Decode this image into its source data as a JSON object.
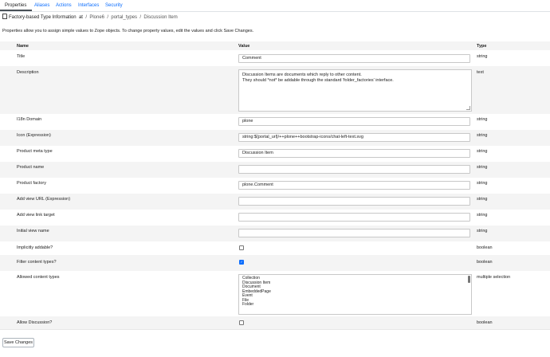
{
  "tabs": [
    "Properties",
    "Aliases",
    "Actions",
    "Interfaces",
    "Security"
  ],
  "breadcrumb": {
    "type_label": "Factory-based Type Information",
    "at": "at",
    "sep": "/",
    "path": [
      "Plone6",
      "portal_types",
      "Discussion Item"
    ]
  },
  "intro": "Properties allow you to assign simple values to Zope objects. To change property values, edit the values and click Save Changes.",
  "columns": {
    "name": "Name",
    "value": "Value",
    "type": "Type"
  },
  "rows": {
    "title": {
      "label": "Title",
      "value": "Comment",
      "type": "string"
    },
    "description": {
      "label": "Description",
      "line1": "Discussion Items are documents which reply to other content.",
      "line2": "They should *not* be addable through the standard 'folder_factories' interface.",
      "type": "text"
    },
    "i18n": {
      "label": "I18n Domain",
      "value": "plone",
      "type": "string"
    },
    "icon": {
      "label": "Icon (Expression)",
      "value": "string:${portal_url}/++plone++bootstrap-icons/chat-left-text.svg",
      "type": "string"
    },
    "meta": {
      "label": "Product meta type",
      "value": "Discussion Item",
      "type": "string"
    },
    "pname": {
      "label": "Product name",
      "value": "",
      "type": "string"
    },
    "factory": {
      "label": "Product factory",
      "value": "plone.Comment",
      "type": "string"
    },
    "viewurl": {
      "label": "Add view URL (Expression)",
      "value": "",
      "type": "string"
    },
    "viewtarget": {
      "label": "Add view link target",
      "value": "",
      "type": "string"
    },
    "initview": {
      "label": "Initial view name",
      "value": "",
      "type": "string"
    },
    "implicit": {
      "label": "Implicitly addable?",
      "checked": false,
      "type": "boolean"
    },
    "filter": {
      "label": "Filter content types?",
      "checked": true,
      "type": "boolean",
      "check_glyph": "✓"
    },
    "allowed": {
      "label": "Allowed content types",
      "type": "multiple selection",
      "options": [
        "Collection",
        "Discussion Item",
        "Document",
        "EmbeddedPage",
        "Event",
        "File",
        "Folder"
      ]
    },
    "discussion": {
      "label": "Allow Discussion?",
      "checked": false,
      "type": "boolean"
    }
  },
  "save_label": "Save Changes"
}
